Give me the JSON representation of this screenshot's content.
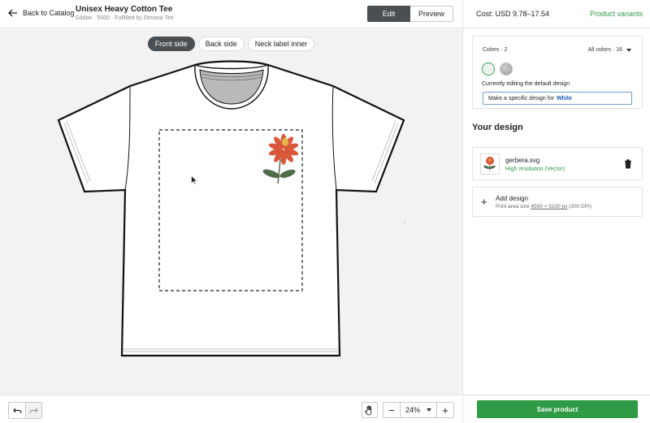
{
  "header": {
    "back_label": "Back to Catalog",
    "product_title": "Unisex Heavy Cotton Tee",
    "product_subtitle": "Gildan · 5000 · Fulfilled by Dimona Tee",
    "mode_tabs": [
      "Edit",
      "Preview"
    ],
    "active_mode": "Edit",
    "cost": "Cost: USD 9.78–17.54",
    "variants_link": "Product variants"
  },
  "canvas": {
    "views": [
      "Front side",
      "Back side",
      "Neck label inner"
    ],
    "active_view": "Front side",
    "print_area_style": "dashed",
    "shirt_color": "#ffffff",
    "graphic": "gerbera-flower"
  },
  "toolbar": {
    "undo_icon": "undo-icon",
    "redo_icon": "redo-icon",
    "hand_icon": "hand-icon",
    "zoom_out": "−",
    "zoom_in": "+",
    "zoom_level": "24%"
  },
  "colors_panel": {
    "label": "Colors · 2",
    "all_colors": "All colors · 16",
    "swatches": [
      {
        "name": "White",
        "hex": "#eef1ee",
        "selected": true
      },
      {
        "name": "Heather",
        "hex": "#b5b5b5",
        "selected": false
      }
    ],
    "editing_text": "Currently editing the default design",
    "specific_prefix": "Make a specific design for",
    "specific_color": "White"
  },
  "design_panel": {
    "heading": "Your design",
    "file": {
      "name": "gerbera.svg",
      "resolution": "High resolution (Vector)"
    },
    "add": {
      "title": "Add design",
      "sub_prefix": "Print area size",
      "size": "4500 × 5100 px",
      "dpi": "(300 DPI)"
    }
  },
  "footer": {
    "save_label": "Save product"
  },
  "colors": {
    "accent_green": "#2f9b47",
    "dark_button": "#4a4f53",
    "link_blue": "#1a5fb4"
  }
}
